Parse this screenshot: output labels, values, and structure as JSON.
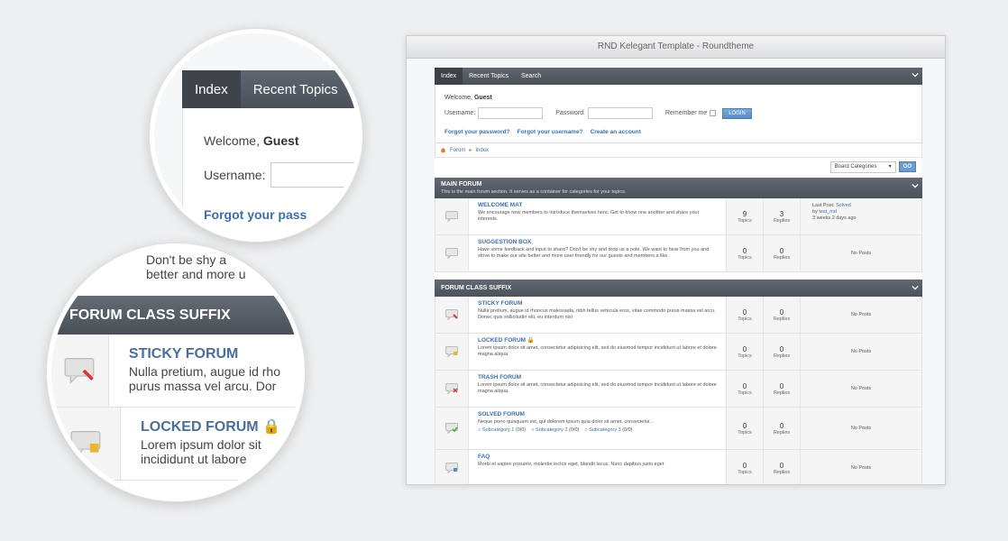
{
  "window": {
    "title": "RND Kelegant Template - Roundtheme"
  },
  "tabs": [
    {
      "label": "Index"
    },
    {
      "label": "Recent Topics"
    },
    {
      "label": "Search"
    }
  ],
  "login": {
    "welcome_prefix": "Welcome,",
    "user": "Guest",
    "username_label": "Username:",
    "password_label": "Password:",
    "remember_label": "Remember me",
    "login_button": "LOGIN",
    "forgot_password": "Forgot your password?",
    "forgot_username": "Forgot your username?",
    "create_account": "Create an account"
  },
  "breadcrumb": {
    "forum": "Forum",
    "sep": "▸",
    "index": "Index"
  },
  "jump": {
    "select_value": "Board Categories",
    "go": "GO"
  },
  "categories": [
    {
      "title": "MAIN FORUM",
      "desc": "This is the main forum section. It serves as a container for categories for your topics.",
      "forums": [
        {
          "name": "WELCOME MAT",
          "desc": "We encourage new members to introduce themselves here. Get to know one another and share your interests.",
          "topics": "9",
          "topics_label": "Topics",
          "replies": "3",
          "replies_label": "Replies",
          "last_label": "Last Post:",
          "last_title": "Solved",
          "last_by": "by",
          "last_user": "test_md",
          "last_time": "3 weeks 2 days ago"
        },
        {
          "name": "SUGGESTION BOX",
          "desc": "Have some feedback and input to share? Don't be shy and drop us a note. We want to hear from you and strive to make our site better and more user friendly for our guests and members a like.",
          "topics": "0",
          "topics_label": "Topics",
          "replies": "0",
          "replies_label": "Replies",
          "no_posts": "No Posts"
        }
      ]
    },
    {
      "title": "FORUM CLASS SUFFIX",
      "forums": [
        {
          "name": "STICKY FORUM",
          "desc": "Nulla pretium, augue id rhoncus malesuada, nibh tellus vehicula eros, vitae commodo purus massa vel arcu. Donec quis sollicitudin elit, eu interdum nisl",
          "topics": "0",
          "topics_label": "Topics",
          "replies": "0",
          "replies_label": "Replies",
          "no_posts": "No Posts"
        },
        {
          "name": "LOCKED FORUM",
          "desc": "Lorem ipsum dolor sit amet, consectetur adipisicing elit, sed do eiusmod tempor incididunt ut labore et dolore magna aliqua.",
          "topics": "0",
          "topics_label": "Topics",
          "replies": "0",
          "replies_label": "Replies",
          "no_posts": "No Posts"
        },
        {
          "name": "TRASH FORUM",
          "desc": "Lorem ipsum dolor sit amet, consectetur adipisicing elit, sed do eiusmod tempor incididunt ut labore et dolore magna aliqua.",
          "topics": "0",
          "topics_label": "Topics",
          "replies": "0",
          "replies_label": "Replies",
          "no_posts": "No Posts"
        },
        {
          "name": "SOLVED FORUM",
          "desc": "Neque porro quisquam est, qui dolorem ipsum quia dolor sit amet, consectetur...",
          "subcategories": [
            "Subcategory 1",
            "Subcategory 2",
            "Subcategory 3"
          ],
          "sub_counts": [
            "(0/0)",
            "(0/0)",
            "(0/0)"
          ],
          "topics": "0",
          "topics_label": "Topics",
          "replies": "0",
          "replies_label": "Replies",
          "no_posts": "No Posts"
        },
        {
          "name": "FAQ",
          "desc": "Morbi et sapien posuere, molestie lectus eget, blandit lacus. Nunc dapibus justo eget",
          "topics": "0",
          "topics_label": "Topics",
          "replies": "0",
          "replies_label": "Replies",
          "no_posts": "No Posts"
        }
      ]
    }
  ],
  "zoom1": {
    "tab1": "Index",
    "tab2": "Recent Topics",
    "welcome_prefix": "Welcome,",
    "user": "Guest",
    "username_label": "Username:",
    "forgot": "Forgot your pass"
  },
  "zoom2": {
    "line1": "Don't be shy a",
    "line2": "better and more u",
    "header": "FORUM CLASS SUFFIX",
    "row1_name": "STICKY FORUM",
    "row1_l1": "Nulla pretium, augue id rho",
    "row1_l2": "purus massa vel arcu. Dor",
    "row2_name": "LOCKED FORUM",
    "row2_l1": "Lorem ipsum dolor sit",
    "row2_l2": "incididunt ut labore"
  },
  "colors": {
    "header_bar": "#4c525a",
    "link": "#3e6fa6",
    "button": "#6a9ccf"
  }
}
